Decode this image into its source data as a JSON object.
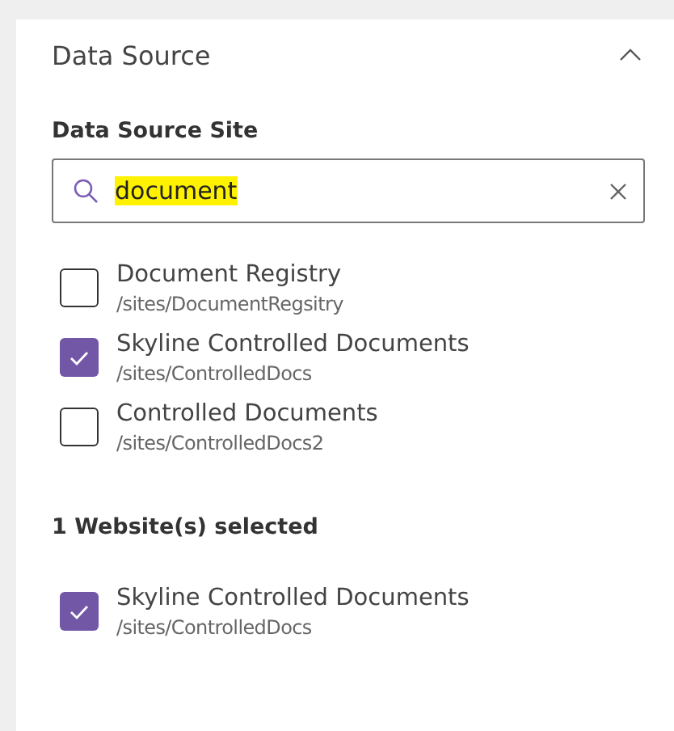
{
  "section": {
    "title": "Data Source",
    "expanded": true
  },
  "site_field": {
    "label": "Data Source Site",
    "value": "document"
  },
  "results": [
    {
      "name": "Document Registry",
      "path": "/sites/DocumentRegsitry",
      "checked": false
    },
    {
      "name": "Skyline Controlled Documents",
      "path": "/sites/ControlledDocs",
      "checked": true
    },
    {
      "name": "Controlled Documents",
      "path": "/sites/ControlledDocs2",
      "checked": false
    }
  ],
  "selected_summary": "1 Website(s) selected",
  "selected_sites": [
    {
      "name": "Skyline Controlled Documents",
      "path": "/sites/ControlledDocs",
      "checked": true
    }
  ]
}
